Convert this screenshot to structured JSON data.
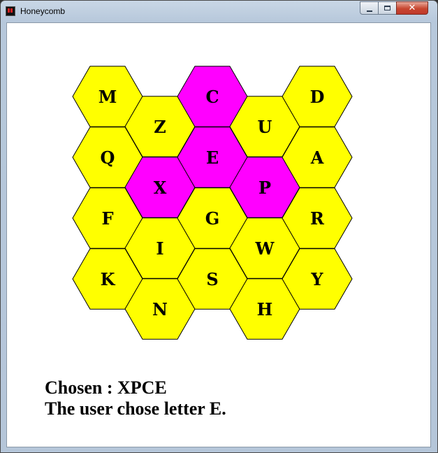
{
  "window": {
    "title": "Honeycomb",
    "icon": "app-icon",
    "controls": [
      "minimize-icon",
      "maximize-icon",
      "close-icon"
    ]
  },
  "colors": {
    "unselected": "#ffff00",
    "selected": "#ff00ff",
    "outline": "#000000",
    "background": "#ffffff"
  },
  "honeycomb": {
    "columns": [
      [
        {
          "letter": "M",
          "selected": false
        },
        {
          "letter": "Q",
          "selected": false
        },
        {
          "letter": "F",
          "selected": false
        },
        {
          "letter": "K",
          "selected": false
        }
      ],
      [
        {
          "letter": "Z",
          "selected": false
        },
        {
          "letter": "X",
          "selected": true
        },
        {
          "letter": "I",
          "selected": false
        },
        {
          "letter": "N",
          "selected": false
        }
      ],
      [
        {
          "letter": "C",
          "selected": true
        },
        {
          "letter": "E",
          "selected": true
        },
        {
          "letter": "G",
          "selected": false
        },
        {
          "letter": "S",
          "selected": false
        }
      ],
      [
        {
          "letter": "U",
          "selected": false
        },
        {
          "letter": "P",
          "selected": true
        },
        {
          "letter": "W",
          "selected": false
        },
        {
          "letter": "H",
          "selected": false
        }
      ],
      [
        {
          "letter": "D",
          "selected": false
        },
        {
          "letter": "A",
          "selected": false
        },
        {
          "letter": "R",
          "selected": false
        },
        {
          "letter": "Y",
          "selected": false
        }
      ]
    ]
  },
  "status": {
    "chosen": "Chosen : XPCE",
    "message": "The user chose letter E."
  }
}
